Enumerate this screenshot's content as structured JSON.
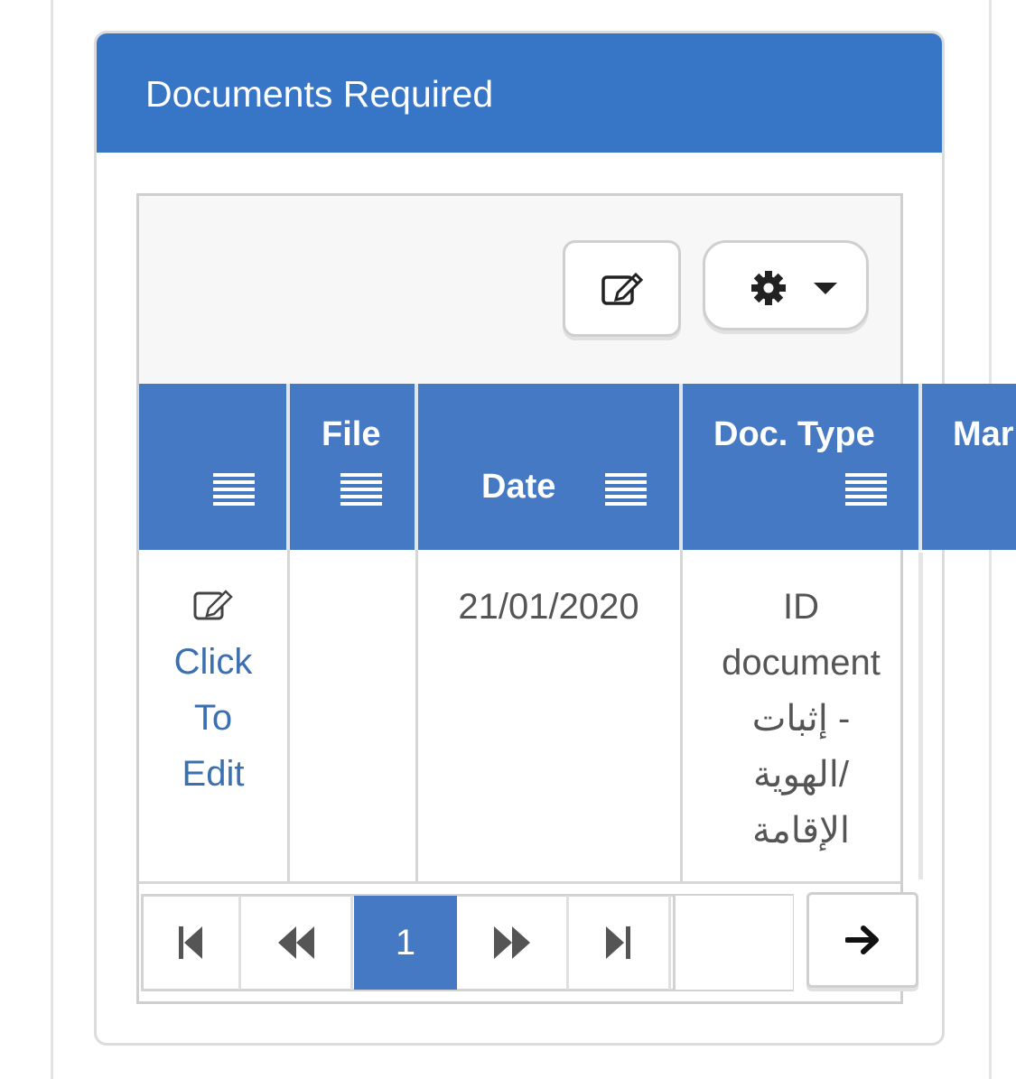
{
  "panel": {
    "title": "Documents Required"
  },
  "toolbar": {
    "edit_icon": "edit-icon",
    "settings_icon": "gear-icon",
    "caret_icon": "caret-down-icon"
  },
  "table": {
    "headers": [
      "",
      "File",
      "Date",
      "Doc. Type",
      "Mar"
    ],
    "row": {
      "edit_label": [
        "Click",
        "To",
        "Edit"
      ],
      "date": "21/01/2020",
      "doc_type": [
        "ID",
        "document",
        "إثبات -",
        "الهوية/",
        "الإقامة"
      ]
    }
  },
  "pager": {
    "current_page": "1"
  },
  "colors": {
    "accent": "#3776c6",
    "header_bg": "#4579c3",
    "link": "#3a6fb0"
  }
}
